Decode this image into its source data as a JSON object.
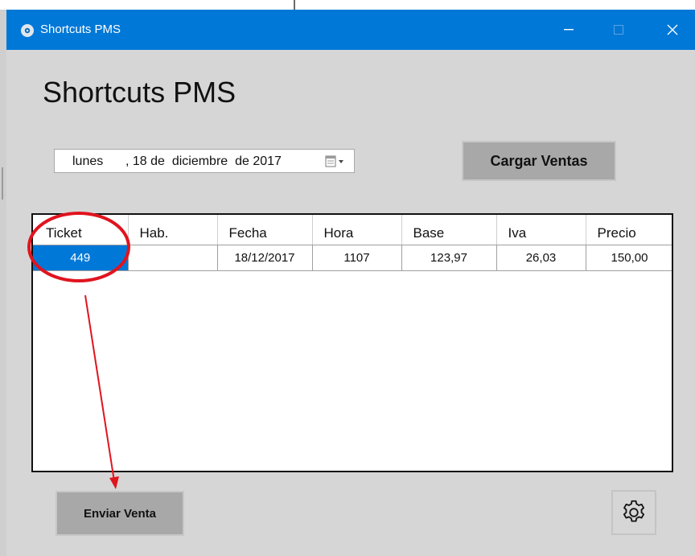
{
  "window": {
    "title": "Shortcuts PMS",
    "titlebar_color": "#0078d7"
  },
  "heading": "Shortcuts PMS",
  "datepicker": {
    "weekday": "lunes",
    "date_rest": ", 18 de  diciembre  de 2017",
    "button_icon": "calendar-dropdown-icon"
  },
  "buttons": {
    "cargar": "Cargar Ventas",
    "enviar": "Enviar Venta",
    "settings_icon": "gear-icon"
  },
  "table": {
    "columns": [
      "Ticket",
      "Hab.",
      "Fecha",
      "Hora",
      "Base",
      "Iva",
      "Precio"
    ],
    "rows": [
      [
        "449",
        "",
        "18/12/2017",
        "1107",
        "123,97",
        "26,03",
        "150,00"
      ]
    ],
    "selected_color": "#0078d7"
  },
  "annotation": {
    "color": "#e0141e",
    "shapes": [
      "ellipse-around-ticket",
      "arrow-to-enviar-venta"
    ]
  }
}
